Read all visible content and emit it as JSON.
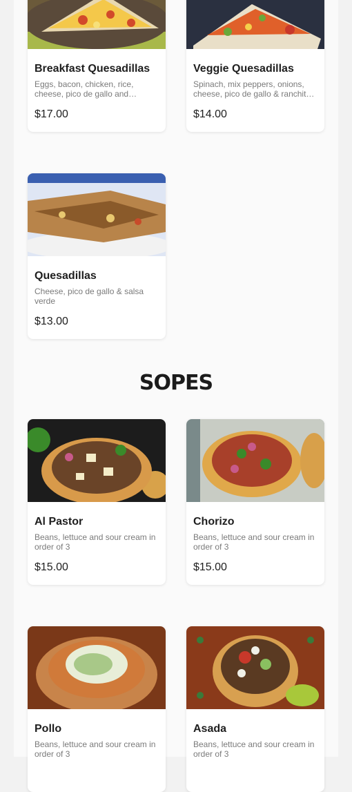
{
  "quesadillas": {
    "items": [
      {
        "name": "Breakfast Quesadillas",
        "description": "Eggs, bacon, chicken, rice, cheese, pico de gallo and…",
        "price": "$17.00",
        "image_icon": "breakfast-quesadilla-photo"
      },
      {
        "name": "Veggie Quesadillas",
        "description": "Spinach, mix peppers, onions, cheese, pico de gallo & ranchit…",
        "price": "$14.00",
        "image_icon": "veggie-quesadilla-photo"
      },
      {
        "name": "Quesadillas",
        "description": "Cheese, pico de gallo & salsa verde",
        "price": "$13.00",
        "image_icon": "quesadilla-photo"
      }
    ]
  },
  "sopes": {
    "title": "SOPES",
    "items": [
      {
        "name": "Al Pastor",
        "description": "Beans, lettuce and sour cream in order of 3",
        "price": "$15.00",
        "image_icon": "al-pastor-sope-photo"
      },
      {
        "name": "Chorizo",
        "description": "Beans, lettuce and sour cream in order of 3",
        "price": "$15.00",
        "image_icon": "chorizo-sope-photo"
      },
      {
        "name": "Pollo",
        "description": "Beans, lettuce and sour cream in order of 3",
        "price": "",
        "image_icon": "pollo-sope-photo"
      },
      {
        "name": "Asada",
        "description": "Beans, lettuce and sour cream in order of 3",
        "price": "",
        "image_icon": "asada-sope-photo"
      }
    ]
  },
  "colors": {
    "background": "#f2f2f2",
    "card": "#ffffff",
    "text": "#1e1e1e",
    "muted": "#7a7a7a"
  }
}
